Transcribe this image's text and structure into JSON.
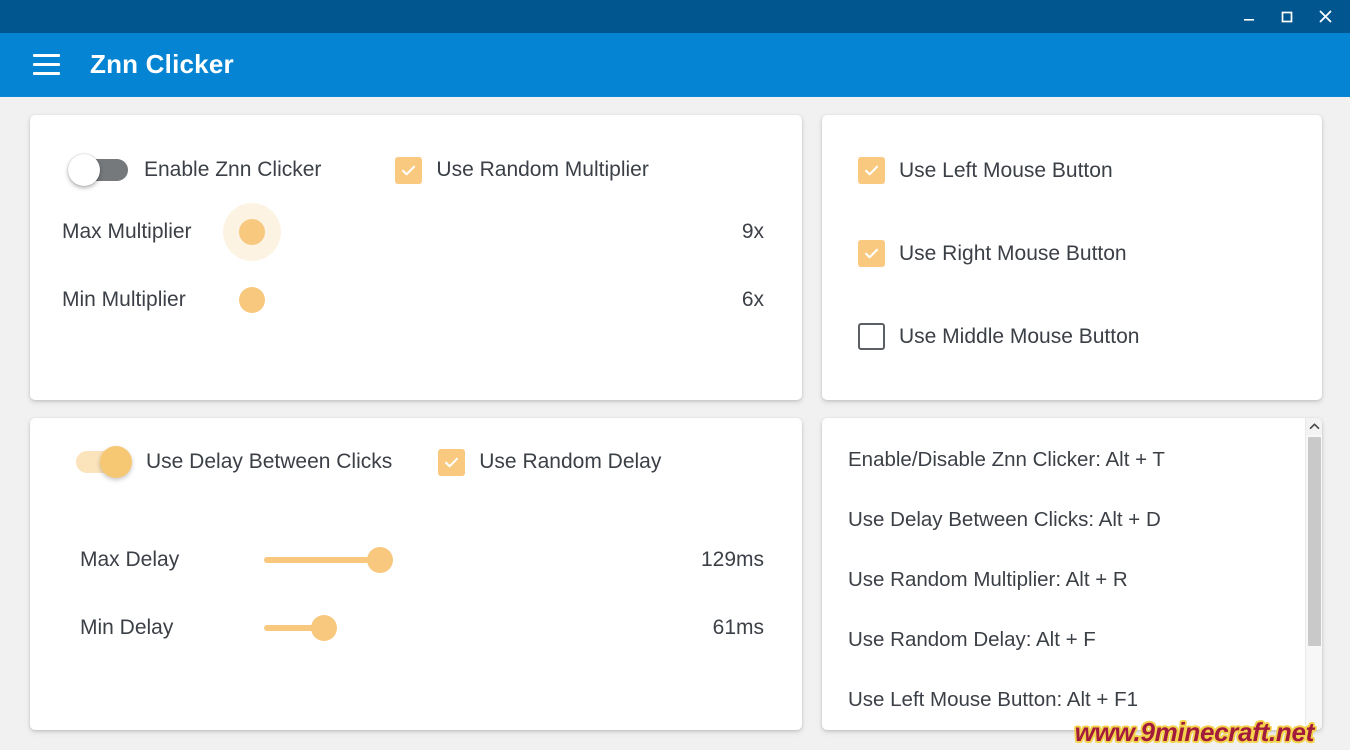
{
  "window": {
    "minimize_icon": "minimize-icon",
    "maximize_icon": "maximize-icon",
    "close_icon": "close-icon"
  },
  "appbar": {
    "menu_icon": "hamburger-menu-icon",
    "title": "Znn Clicker",
    "background": "#0484d2",
    "titlebar_background": "#02568f"
  },
  "accent": {
    "amber": "#f8c87e",
    "toggle_off": "#75797c"
  },
  "clicker_card": {
    "enable_toggle": {
      "label": "Enable Znn Clicker",
      "state": "off"
    },
    "random_multiplier_checkbox": {
      "label": "Use Random Multiplier",
      "checked": true
    },
    "sliders": [
      {
        "label": "Max Multiplier",
        "value": "9x",
        "percent": 0,
        "focused": true
      },
      {
        "label": "Min Multiplier",
        "value": "6x",
        "percent": 0,
        "focused": false
      }
    ]
  },
  "mouse_card": {
    "checkboxes": [
      {
        "label": "Use Left Mouse Button",
        "checked": true
      },
      {
        "label": "Use Right Mouse Button",
        "checked": true
      },
      {
        "label": "Use Middle Mouse Button",
        "checked": false
      }
    ]
  },
  "delay_card": {
    "delay_toggle": {
      "label": "Use Delay Between Clicks",
      "state": "on"
    },
    "random_delay_checkbox": {
      "label": "Use Random Delay",
      "checked": true
    },
    "sliders": [
      {
        "label": "Max Delay",
        "value": "129ms",
        "percent": 29,
        "focused": false
      },
      {
        "label": "Min Delay",
        "value": "61ms",
        "percent": 15,
        "focused": false
      }
    ]
  },
  "hotkeys_card": {
    "items": [
      "Enable/Disable Znn Clicker: Alt + T",
      "Use Delay Between Clicks: Alt + D",
      "Use Random Multiplier: Alt + R",
      "Use Random Delay: Alt + F",
      "Use Left Mouse Button: Alt + F1"
    ],
    "scroll_up_icon": "chevron-up-icon"
  },
  "watermark": {
    "text": "www.9minecraft.net"
  }
}
